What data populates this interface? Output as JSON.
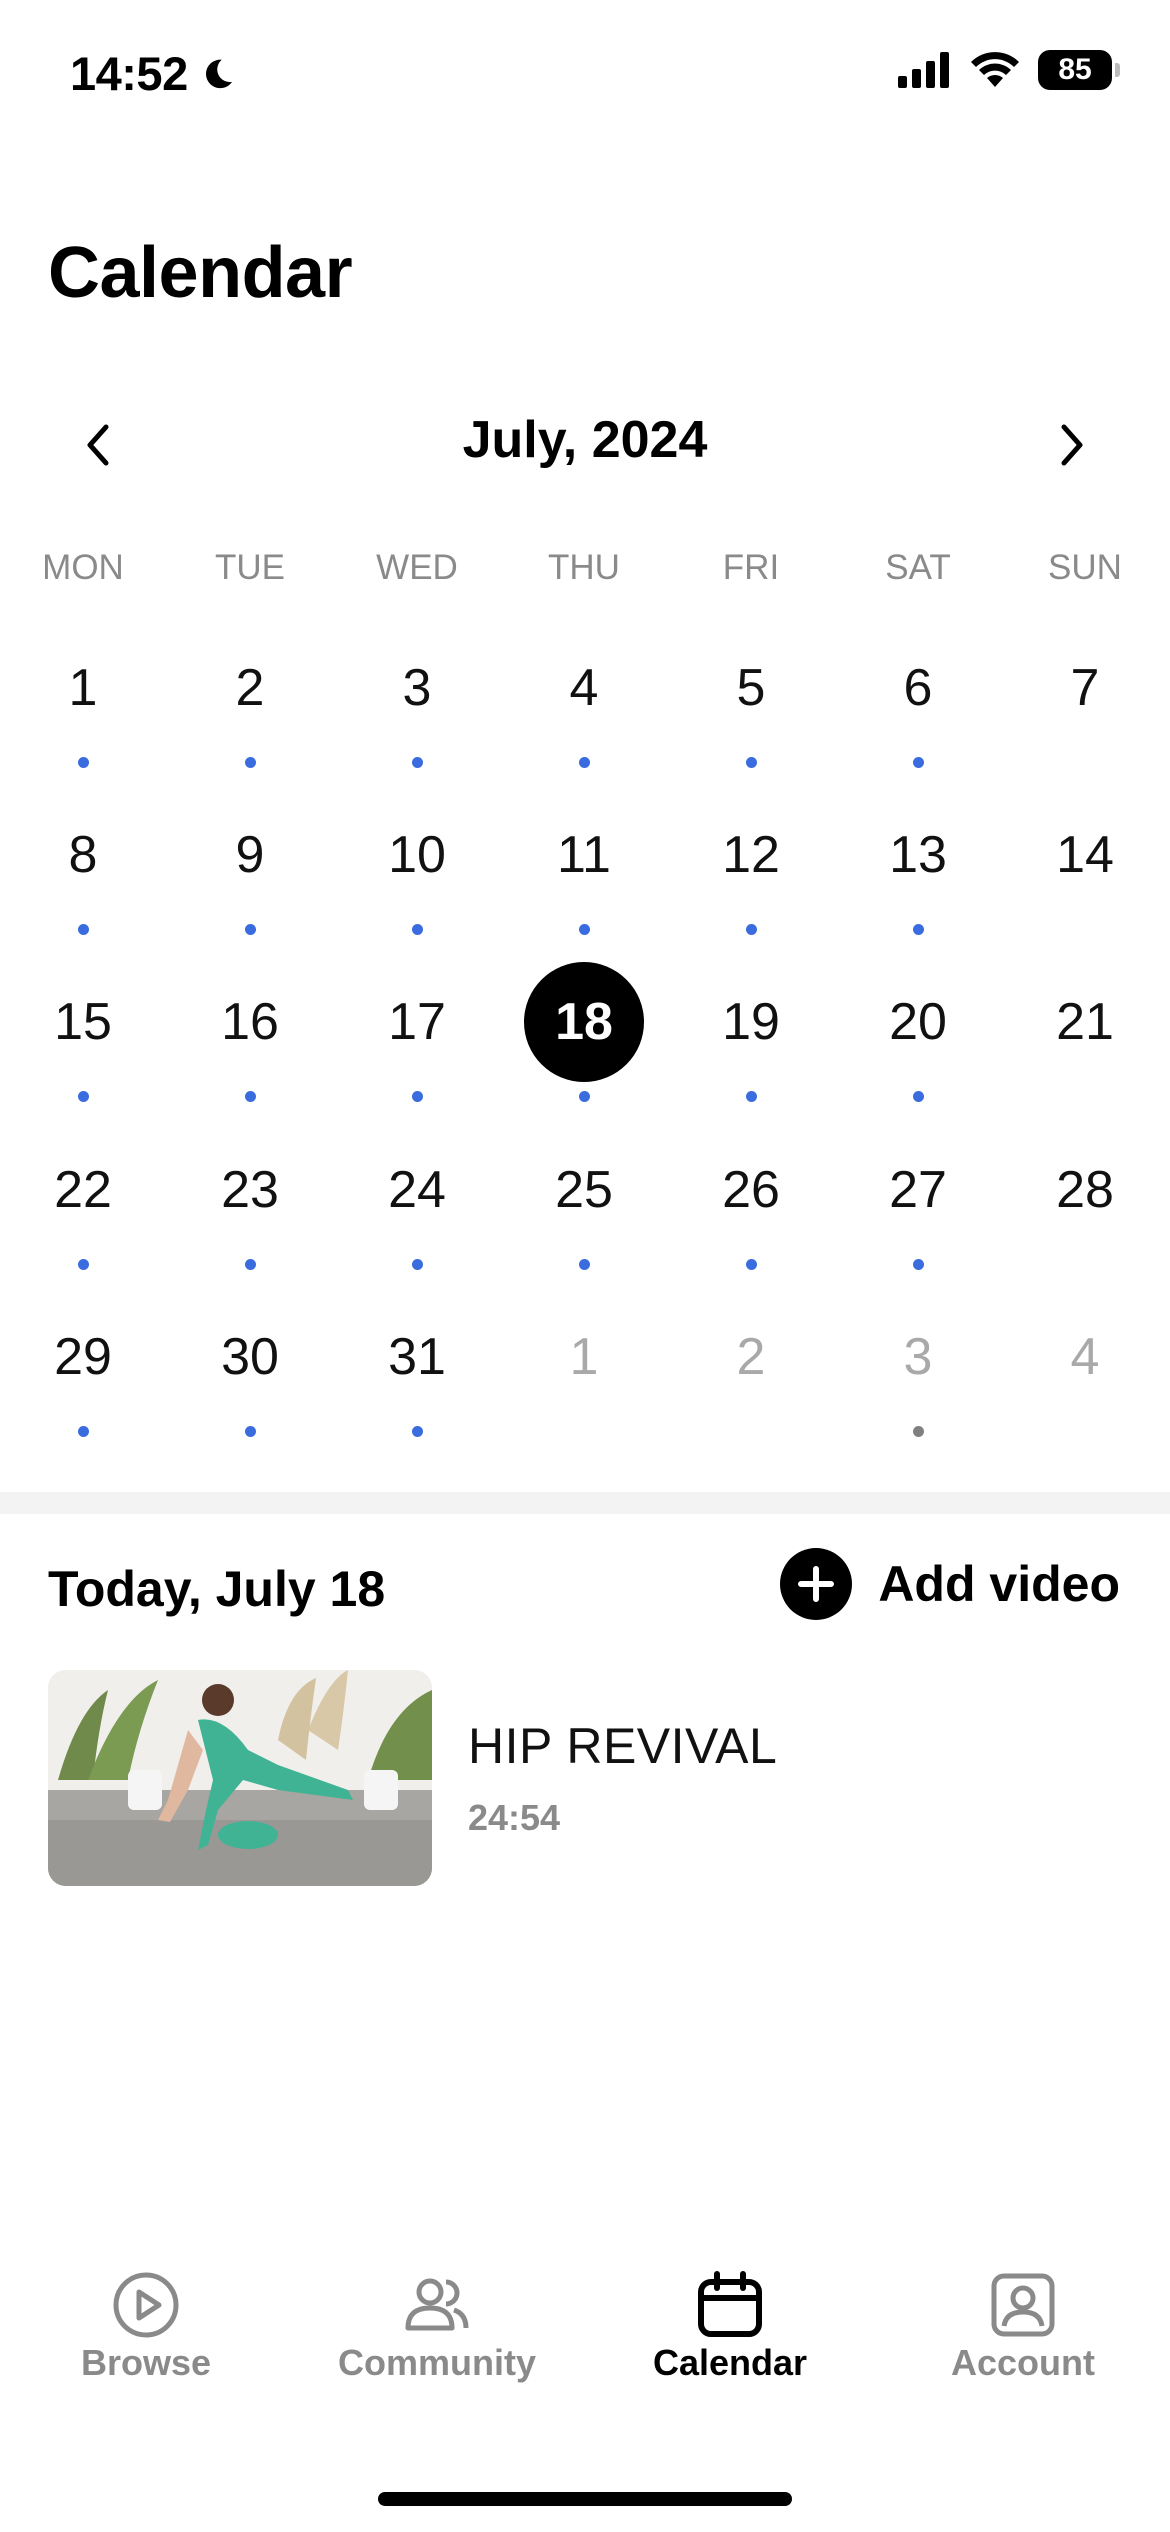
{
  "status_bar": {
    "time": "14:52",
    "battery": "85"
  },
  "page_title": "Calendar",
  "month": {
    "label": "July, 2024"
  },
  "weekdays": [
    "MON",
    "TUE",
    "WED",
    "THU",
    "FRI",
    "SAT",
    "SUN"
  ],
  "weeks": [
    [
      {
        "d": "1",
        "dot": "blue"
      },
      {
        "d": "2",
        "dot": "blue"
      },
      {
        "d": "3",
        "dot": "blue"
      },
      {
        "d": "4",
        "dot": "blue"
      },
      {
        "d": "5",
        "dot": "blue"
      },
      {
        "d": "6",
        "dot": "blue"
      },
      {
        "d": "7",
        "dot": null
      }
    ],
    [
      {
        "d": "8",
        "dot": "blue"
      },
      {
        "d": "9",
        "dot": "blue"
      },
      {
        "d": "10",
        "dot": "blue"
      },
      {
        "d": "11",
        "dot": "blue"
      },
      {
        "d": "12",
        "dot": "blue"
      },
      {
        "d": "13",
        "dot": "blue"
      },
      {
        "d": "14",
        "dot": null
      }
    ],
    [
      {
        "d": "15",
        "dot": "blue"
      },
      {
        "d": "16",
        "dot": "blue"
      },
      {
        "d": "17",
        "dot": "blue"
      },
      {
        "d": "18",
        "dot": "blue",
        "selected": true
      },
      {
        "d": "19",
        "dot": "blue"
      },
      {
        "d": "20",
        "dot": "blue"
      },
      {
        "d": "21",
        "dot": null
      }
    ],
    [
      {
        "d": "22",
        "dot": "blue"
      },
      {
        "d": "23",
        "dot": "blue"
      },
      {
        "d": "24",
        "dot": "blue"
      },
      {
        "d": "25",
        "dot": "blue"
      },
      {
        "d": "26",
        "dot": "blue"
      },
      {
        "d": "27",
        "dot": "blue"
      },
      {
        "d": "28",
        "dot": null
      }
    ],
    [
      {
        "d": "29",
        "dot": "blue"
      },
      {
        "d": "30",
        "dot": "blue"
      },
      {
        "d": "31",
        "dot": "blue"
      },
      {
        "d": "1",
        "dot": null,
        "muted": true
      },
      {
        "d": "2",
        "dot": null,
        "muted": true
      },
      {
        "d": "3",
        "dot": "grey",
        "muted": true
      },
      {
        "d": "4",
        "dot": null,
        "muted": true
      }
    ]
  ],
  "today": {
    "label": "Today, July 18",
    "add_video_label": "Add video",
    "video": {
      "title": "HIP REVIVAL",
      "duration": "24:54"
    }
  },
  "tabs": [
    {
      "label": "Browse",
      "icon": "play-circle-icon"
    },
    {
      "label": "Community",
      "icon": "people-icon"
    },
    {
      "label": "Calendar",
      "icon": "calendar-icon",
      "active": true
    },
    {
      "label": "Account",
      "icon": "person-square-icon"
    }
  ],
  "colors": {
    "event_dot": "#3a6ce0",
    "muted_dot": "#808080",
    "accent": "#000000"
  }
}
